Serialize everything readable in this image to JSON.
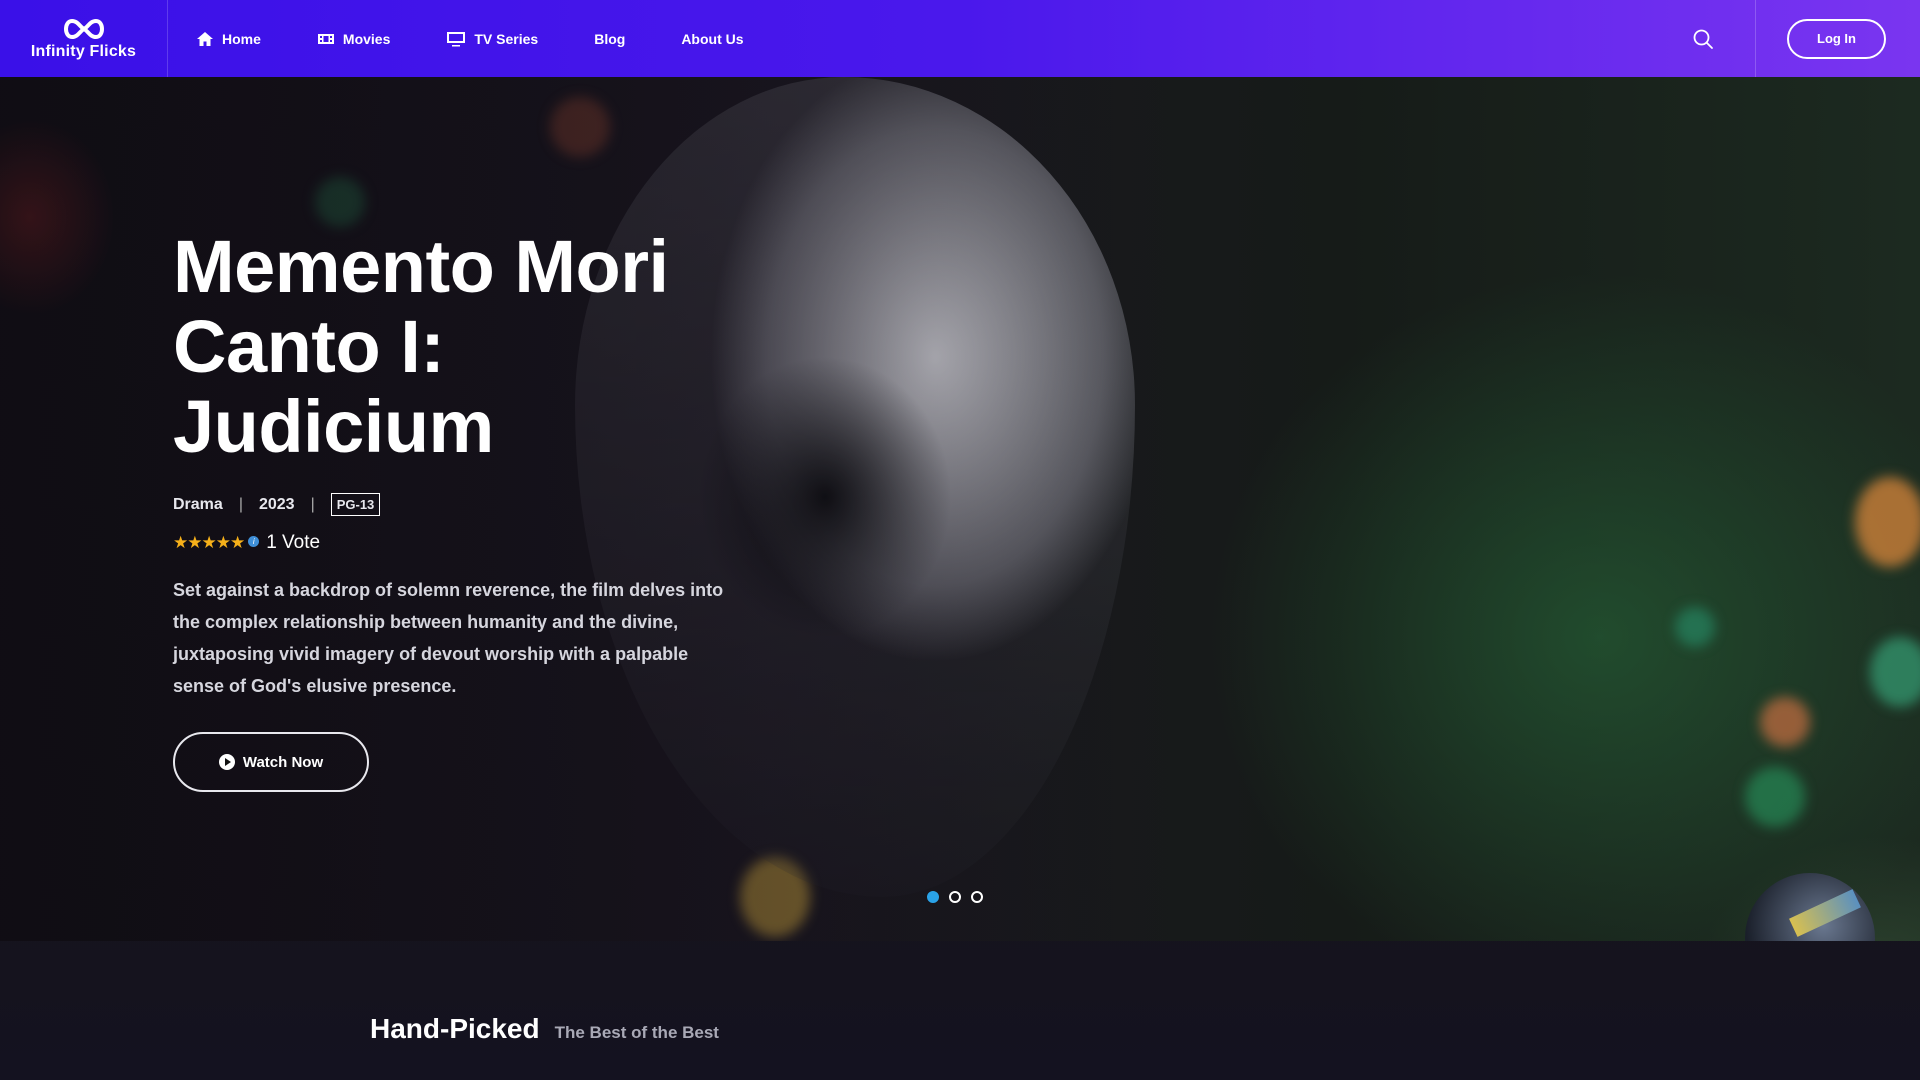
{
  "brand": {
    "name": "Infinity Flicks"
  },
  "nav": {
    "items": [
      {
        "label": "Home",
        "icon": "home-icon"
      },
      {
        "label": "Movies",
        "icon": "film-icon"
      },
      {
        "label": "TV Series",
        "icon": "tv-icon"
      },
      {
        "label": "Blog"
      },
      {
        "label": "About Us"
      }
    ]
  },
  "header": {
    "login_label": "Log In",
    "search_icon": "search-icon"
  },
  "hero": {
    "title_lines": [
      "Memento Mori",
      "Canto I:",
      "Judicium"
    ],
    "genre": "Drama",
    "year": "2023",
    "rating": "PG-13",
    "stars": 5,
    "votes": "1 Vote",
    "description": "Set against a backdrop of solemn reverence, the film delves into the complex relationship between humanity and the divine, juxtaposing vivid imagery of devout worship with a palpable sense of God's elusive presence.",
    "watch_label": "Watch Now",
    "slides": 3,
    "active_slide": 1
  },
  "section": {
    "title": "Hand-Picked",
    "subtitle": "The Best of the Best"
  },
  "colors": {
    "header_start": "#3a10e8",
    "header_end": "#7a35f0",
    "star": "#f6b01a",
    "active_dot": "#2aa3e8"
  }
}
